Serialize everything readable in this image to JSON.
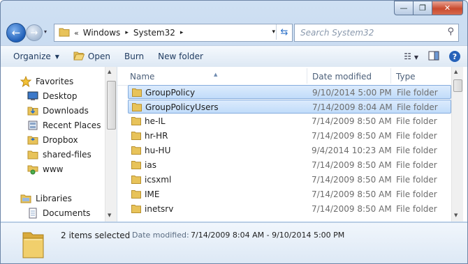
{
  "window": {
    "min_glyph": "—",
    "max_glyph": "❐",
    "close_glyph": "✕"
  },
  "nav": {
    "back_glyph": "←",
    "forward_glyph": "→",
    "recent_glyph": "▾",
    "address_prefix": "«",
    "breadcrumb": [
      "Windows",
      "System32"
    ],
    "crumb_sep": "▸",
    "address_drop": "▾",
    "refresh_glyph": "⇆",
    "search_placeholder": "Search System32",
    "search_icon_glyph": "⚲"
  },
  "toolbar": {
    "organize": "Organize",
    "organize_arrow": "▼",
    "open": "Open",
    "burn": "Burn",
    "new_folder": "New folder",
    "views_glyph": "☷",
    "views_arrow": "▼",
    "help_glyph": "?"
  },
  "navpane": {
    "favorites": "Favorites",
    "items": [
      "Desktop",
      "Downloads",
      "Recent Places",
      "Dropbox",
      "shared-files",
      "www"
    ],
    "libraries": "Libraries",
    "library_items": [
      "Documents"
    ]
  },
  "columns": {
    "name": "Name",
    "date": "Date modified",
    "type": "Type"
  },
  "files": [
    {
      "name": "GroupPolicy",
      "date": "9/10/2014 5:00 PM",
      "type": "File folder",
      "selected": true
    },
    {
      "name": "GroupPolicyUsers",
      "date": "7/14/2009 8:04 AM",
      "type": "File folder",
      "selected": true
    },
    {
      "name": "he-IL",
      "date": "7/14/2009 8:50 AM",
      "type": "File folder",
      "selected": false
    },
    {
      "name": "hr-HR",
      "date": "7/14/2009 8:50 AM",
      "type": "File folder",
      "selected": false
    },
    {
      "name": "hu-HU",
      "date": "9/4/2014 10:23 AM",
      "type": "File folder",
      "selected": false
    },
    {
      "name": "ias",
      "date": "7/14/2009 8:50 AM",
      "type": "File folder",
      "selected": false
    },
    {
      "name": "icsxml",
      "date": "7/14/2009 8:50 AM",
      "type": "File folder",
      "selected": false
    },
    {
      "name": "IME",
      "date": "7/14/2009 8:50 AM",
      "type": "File folder",
      "selected": false
    },
    {
      "name": "inetsrv",
      "date": "7/14/2009 8:50 AM",
      "type": "File folder",
      "selected": false
    }
  ],
  "details": {
    "count": "2 items selected",
    "date_label": "Date modified:",
    "date_value": "7/14/2009 8:04 AM - 9/10/2014 5:00 PM"
  },
  "colors": {
    "folder": "#e8c35a",
    "selection": "#c9dffa",
    "accent": "#2a6fc9"
  }
}
